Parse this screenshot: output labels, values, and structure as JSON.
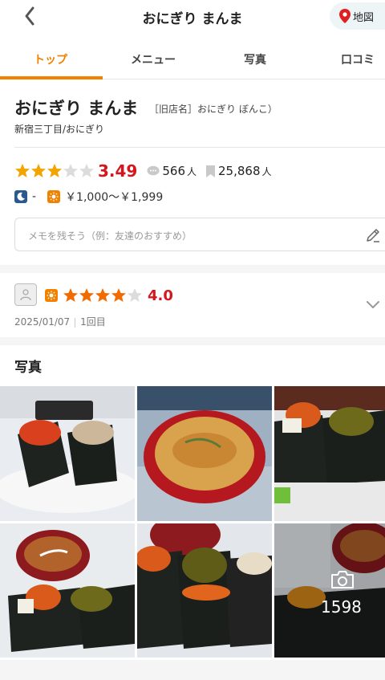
{
  "header": {
    "title": "おにぎり まんま",
    "map_label": "地図"
  },
  "tabs": [
    {
      "label": "トップ",
      "active": true
    },
    {
      "label": "メニュー",
      "active": false
    },
    {
      "label": "写真",
      "active": false
    },
    {
      "label": "口コミ",
      "active": false
    }
  ],
  "shop": {
    "name": "おにぎり まんま",
    "former_name": "［旧店名］おにぎり ぼんこ）",
    "area_genre": "新宿三丁目/おにぎり",
    "rating": "3.49",
    "rating_value": 3.49,
    "reviews_count": "566",
    "reviews_unit": "人",
    "bookmarks_count": "25,868",
    "bookmarks_unit": "人",
    "night_price": "-",
    "day_price": "￥1,000～￥1,999",
    "memo_placeholder": "メモを残そう（例：友達のおすすめ）"
  },
  "review": {
    "score": "4.0",
    "score_value": 4.0,
    "date": "2025/01/07",
    "visit": "1回目"
  },
  "photos": {
    "title": "写真",
    "more_count": "1598"
  },
  "colors": {
    "accent": "#f08200",
    "rating_red": "#d3171f",
    "star_gold": "#f2a400",
    "star_orange": "#f26b00",
    "night_badge": "#2a5a8c"
  }
}
